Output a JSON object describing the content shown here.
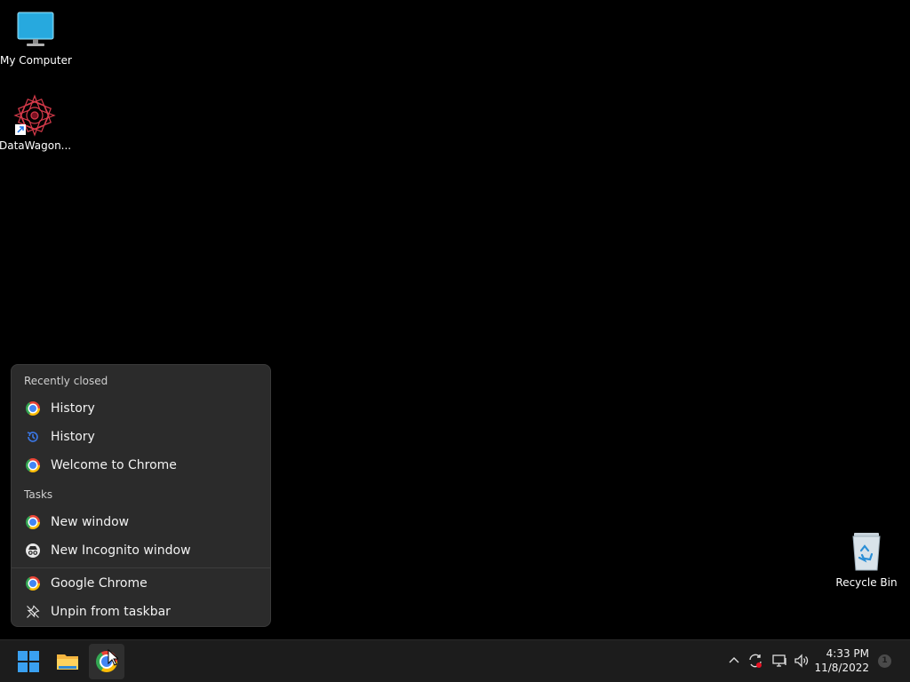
{
  "desktop": {
    "icons": [
      {
        "label": "My Computer"
      },
      {
        "label": "DataWagon..."
      },
      {
        "label": "Recycle Bin"
      }
    ]
  },
  "jumplist": {
    "recently_closed_header": "Recently closed",
    "recently_closed": [
      {
        "label": "History",
        "icon": "chrome-icon"
      },
      {
        "label": "History",
        "icon": "history-icon"
      },
      {
        "label": "Welcome to Chrome",
        "icon": "chrome-icon"
      }
    ],
    "tasks_header": "Tasks",
    "tasks": [
      {
        "label": "New window",
        "icon": "chrome-icon"
      },
      {
        "label": "New Incognito window",
        "icon": "incognito-icon"
      }
    ],
    "app": {
      "label": "Google Chrome",
      "icon": "chrome-icon"
    },
    "unpin": {
      "label": "Unpin from taskbar",
      "icon": "unpin-icon"
    }
  },
  "taskbar": {
    "items": [
      "start-icon",
      "file-explorer-icon",
      "chrome-icon"
    ],
    "tray": {
      "time": "4:33 PM",
      "date": "11/8/2022",
      "notification_count": "1"
    }
  },
  "colors": {
    "menu_bg": "#2b2b2b",
    "taskbar_bg": "#1c1c1c",
    "desktop_bg": "#000000"
  }
}
